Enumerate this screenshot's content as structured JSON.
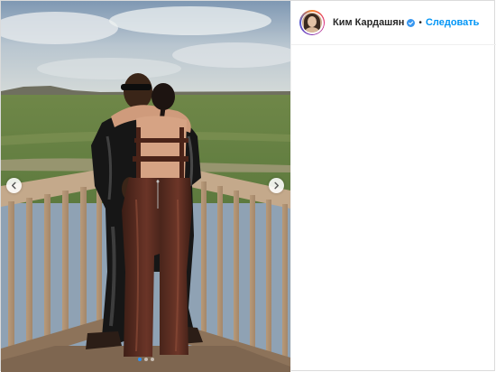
{
  "post": {
    "photo_alt": "",
    "carousel": {
      "prev_icon": "chevron-left-icon",
      "next_icon": "chevron-right-icon",
      "dot_count": 3,
      "active_dot": 0
    }
  },
  "header": {
    "username": "Ким Кардашян",
    "verified_icon": "verified-badge-icon",
    "separator": "•",
    "follow_label": "Следовать"
  },
  "colors": {
    "follow_blue": "#0095f6",
    "verified_blue": "#3897f0",
    "border": "#dbdbdb"
  }
}
